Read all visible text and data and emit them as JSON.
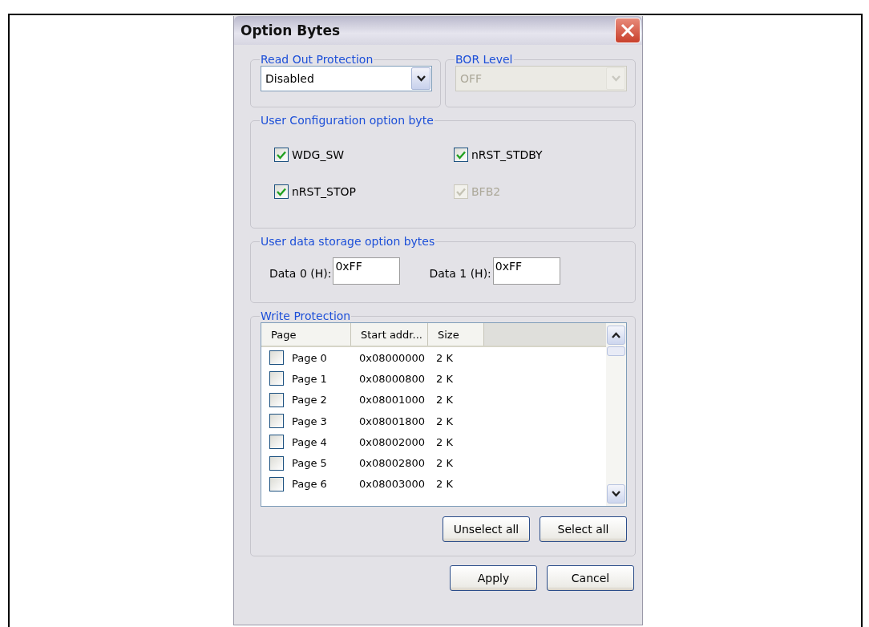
{
  "dialog": {
    "title": "Option Bytes"
  },
  "read_out_protection": {
    "label": "Read Out Protection",
    "value": "Disabled",
    "disabled": false
  },
  "bor_level": {
    "label": "BOR Level",
    "value": "OFF",
    "disabled": true
  },
  "user_configuration": {
    "label": "User Configuration option byte",
    "options": [
      {
        "label": "WDG_SW",
        "checked": true,
        "disabled": false
      },
      {
        "label": "nRST_STDBY",
        "checked": true,
        "disabled": false
      },
      {
        "label": "nRST_STOP",
        "checked": true,
        "disabled": false
      },
      {
        "label": "BFB2",
        "checked": true,
        "disabled": true
      }
    ]
  },
  "user_data": {
    "label": "User data storage option bytes",
    "fields": [
      {
        "label": "Data 0 (H):",
        "value": "0xFF"
      },
      {
        "label": "Data 1 (H):",
        "value": "0xFF"
      }
    ]
  },
  "write_protection": {
    "label": "Write Protection",
    "columns": [
      "Page",
      "Start addr...",
      "Size"
    ],
    "rows": [
      {
        "checked": false,
        "page": "Page 0",
        "address": "0x08000000",
        "size": "2 K"
      },
      {
        "checked": false,
        "page": "Page 1",
        "address": "0x08000800",
        "size": "2 K"
      },
      {
        "checked": false,
        "page": "Page 2",
        "address": "0x08001000",
        "size": "2 K"
      },
      {
        "checked": false,
        "page": "Page 3",
        "address": "0x08001800",
        "size": "2 K"
      },
      {
        "checked": false,
        "page": "Page 4",
        "address": "0x08002000",
        "size": "2 K"
      },
      {
        "checked": false,
        "page": "Page 5",
        "address": "0x08002800",
        "size": "2 K"
      },
      {
        "checked": false,
        "page": "Page 6",
        "address": "0x08003000",
        "size": "2 K"
      }
    ],
    "buttons": [
      "Unselect all",
      "Select all"
    ]
  },
  "buttons": [
    "Apply",
    "Cancel"
  ]
}
